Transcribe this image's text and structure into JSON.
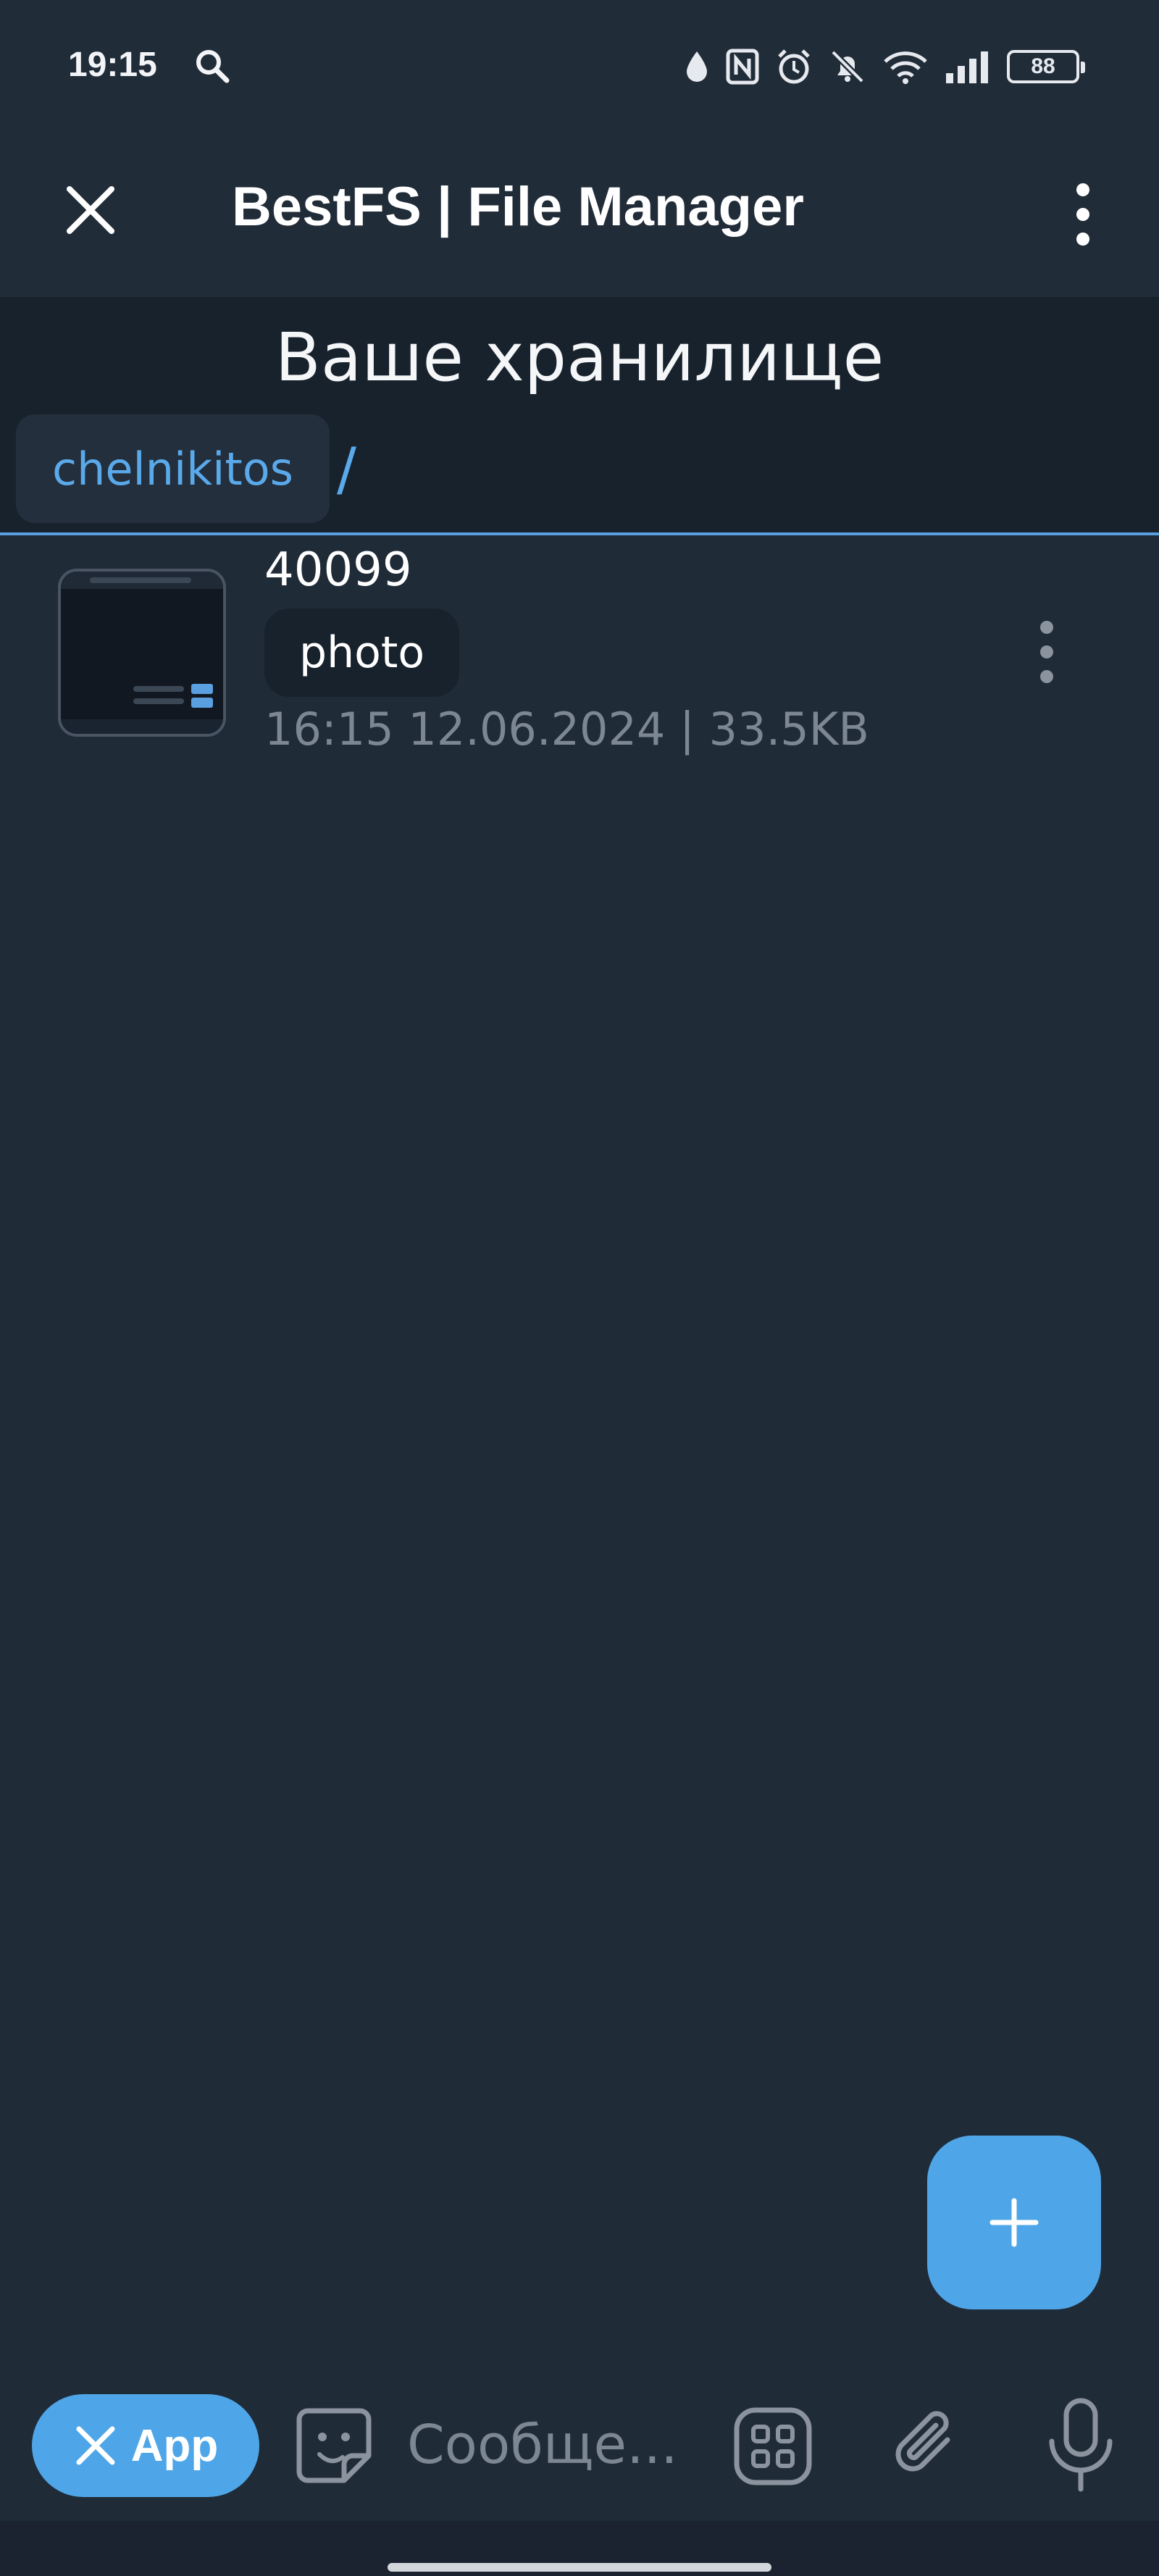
{
  "status_bar": {
    "time": "19:15",
    "battery": "88",
    "icons": [
      "search-icon",
      "drop-icon",
      "nfc-icon",
      "alarm-icon",
      "bell-off-icon",
      "wifi-icon",
      "signal-icon",
      "battery-icon"
    ]
  },
  "header": {
    "title": "BestFS | File Manager",
    "close_icon": "close-icon",
    "menu_icon": "more-vertical-icon"
  },
  "storage": {
    "title": "Ваше хранилище",
    "breadcrumb": [
      {
        "label": "chelnikitos"
      }
    ],
    "separator": "/"
  },
  "files": [
    {
      "name": "40099",
      "tag": "photo",
      "meta": "16:15 12.06.2024 | 33.5KB"
    }
  ],
  "fab": {
    "icon": "plus-icon"
  },
  "bottom_bar": {
    "app_button_label": "App",
    "input_placeholder": "Сообще..."
  },
  "colors": {
    "background": "#202b38",
    "accent": "#4ea6e8",
    "link": "#5aa9ea",
    "muted_text": "#7d8794"
  }
}
